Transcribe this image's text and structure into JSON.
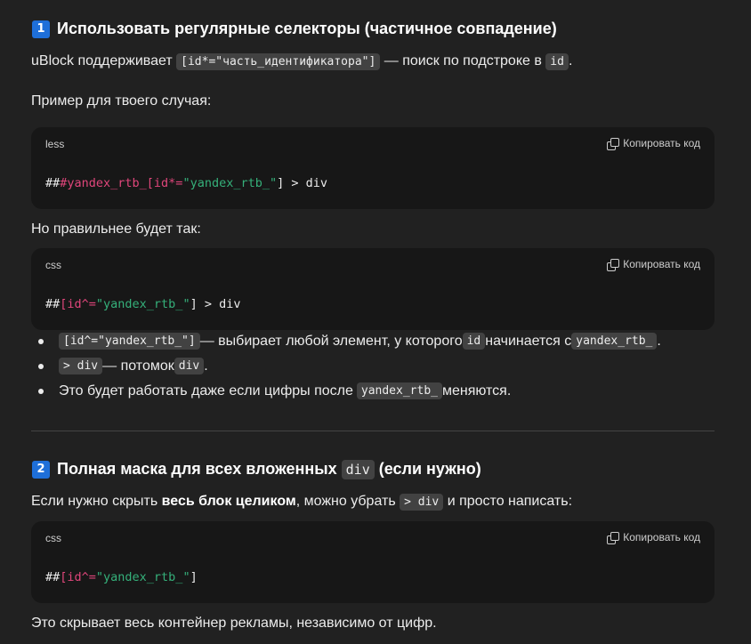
{
  "section1": {
    "badge": "1",
    "title": "Использовать регулярные селекторы (частичное совпадение)",
    "intro_prefix": "uBlock поддерживает ",
    "intro_code": "[id*=\"часть_идентификатора\"]",
    "intro_mid": " — поиск по подстроке в ",
    "intro_code2": "id",
    "intro_suffix": ".",
    "example_label": "Пример для твоего случая:",
    "code1": {
      "lang": "less",
      "copy_label": "Копировать код",
      "tok_a": "##",
      "tok_b": "#yandex_rtb_[id*=",
      "tok_c": "\"yandex_rtb_\"",
      "tok_d": "] > div"
    },
    "better_label": "Но правильнее будет так:",
    "code2": {
      "lang": "css",
      "copy_label": "Копировать код",
      "tok_a": "##",
      "tok_b": "[id^=",
      "tok_c": "\"yandex_rtb_\"",
      "tok_d": "] > div"
    },
    "bullets": [
      {
        "code": "[id^=\"yandex_rtb_\"]",
        "text1": " — выбирает любой элемент, у которого ",
        "code2": "id",
        "text2": " начинается с ",
        "code3": "yandex_rtb_",
        "text3": "."
      },
      {
        "code": "> div",
        "text1": " — потомок ",
        "code2": "div",
        "text2": "."
      },
      {
        "text1": "Это будет работать даже если цифры после ",
        "code": "yandex_rtb_",
        "text2": " меняются."
      }
    ]
  },
  "section2": {
    "badge": "2",
    "title_prefix": "Полная маска для всех вложенных ",
    "title_code": "div",
    "title_suffix": " (если нужно)",
    "intro_prefix": "Если нужно скрыть ",
    "intro_bold": "весь блок целиком",
    "intro_mid": ", можно убрать ",
    "intro_code": "> div",
    "intro_suffix": " и просто написать:",
    "code3": {
      "lang": "css",
      "copy_label": "Копировать код",
      "tok_a": "##",
      "tok_b": "[id^=",
      "tok_c": "\"yandex_rtb_\"",
      "tok_d": "]"
    },
    "outro": "Это скрывает весь контейнер рекламы, независимо от цифр."
  },
  "colors": {
    "background": "#212121",
    "code_bg": "#171717",
    "badge_blue": "#1e6fd9",
    "selector_pink": "#e0467b",
    "string_green": "#35b07a"
  },
  "icons": [
    "copy-icon",
    "keycap-1-emoji",
    "keycap-2-emoji"
  ]
}
